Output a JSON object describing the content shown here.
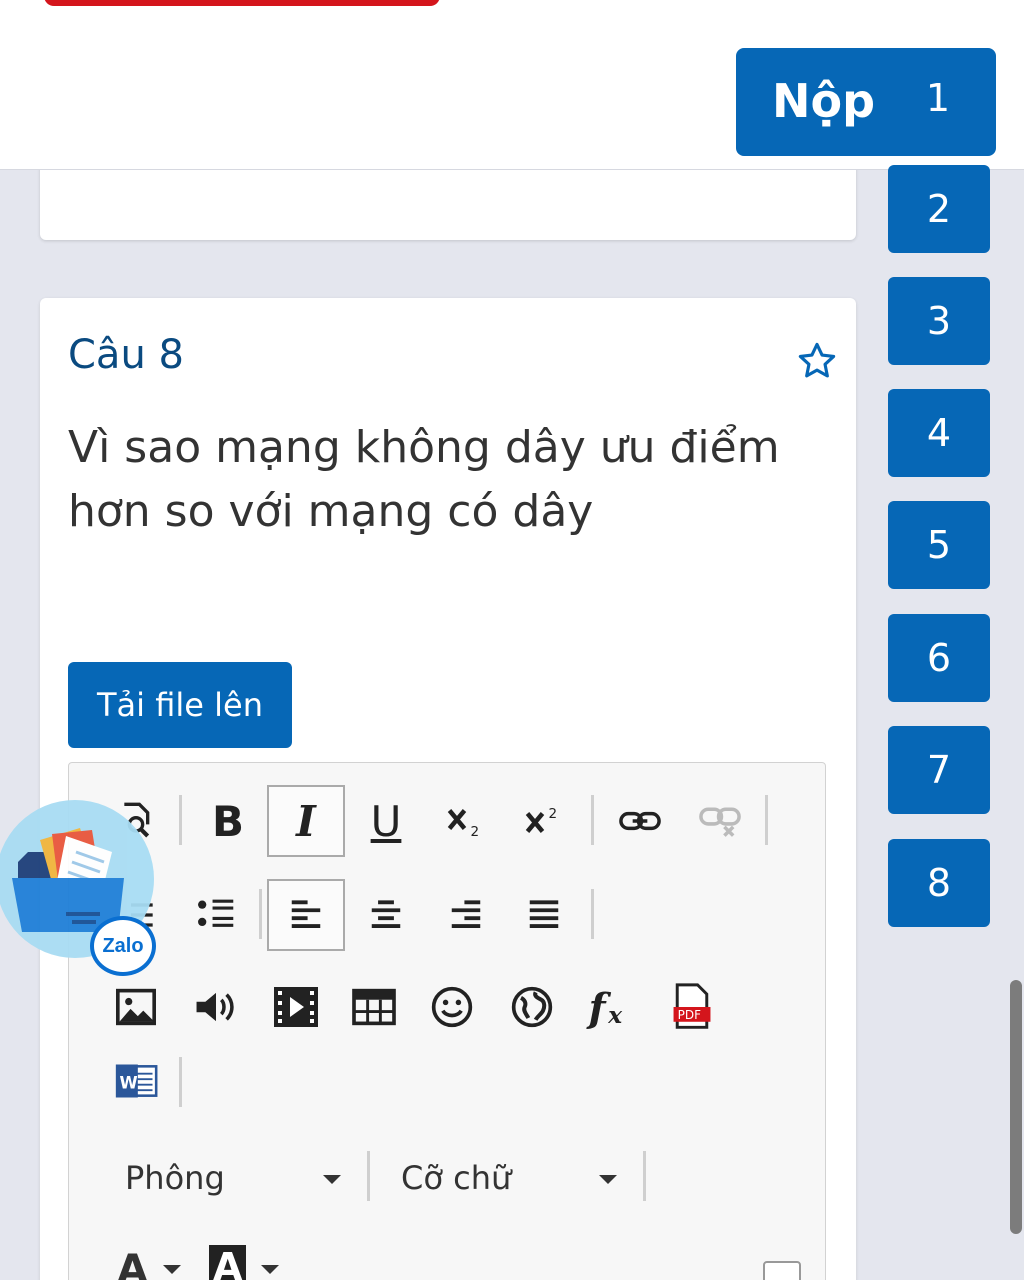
{
  "header": {
    "submit_label": "Nộp",
    "current_number": "1"
  },
  "question_nav": [
    "2",
    "3",
    "4",
    "5",
    "6",
    "7",
    "8"
  ],
  "question": {
    "title": "Câu 8",
    "text": "Vì sao mạng không dây ưu điểm hơn so với mạng có dây",
    "upload_label": "Tải file lên"
  },
  "editor": {
    "font_label": "Phông",
    "size_label": "Cỡ chữ",
    "bold": "B",
    "italic": "I",
    "underline": "U",
    "font_color": "A",
    "bg_color": "A",
    "pdf_label": "PDF",
    "word_label": "W"
  },
  "zalo": {
    "badge": "Zalo"
  },
  "colors": {
    "primary": "#0667b6",
    "title": "#0a4a80",
    "danger": "#d4151c"
  }
}
